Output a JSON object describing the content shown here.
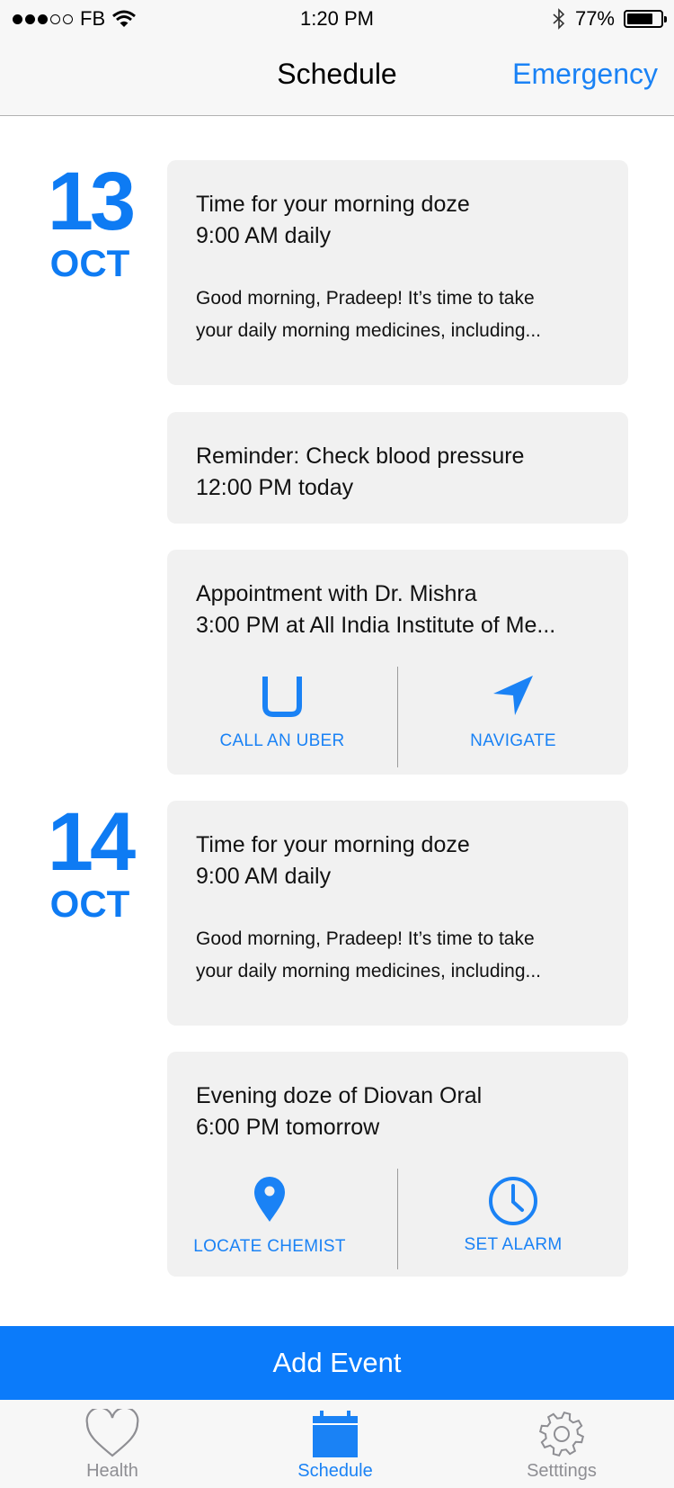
{
  "status_bar": {
    "carrier": "FB",
    "time": "1:20 PM",
    "battery_percent": "77%",
    "battery_level": 0.77,
    "signal_bars_filled": 3,
    "signal_bars_total": 5
  },
  "nav": {
    "title": "Schedule",
    "emergency_label": "Emergency"
  },
  "days": [
    {
      "day": "13",
      "month": "OCT",
      "events": [
        {
          "title": "Time for your morning doze",
          "subtitle": "9:00 AM daily",
          "body_line1": "Good morning, Pradeep! It’s time to take",
          "body_line2": "your daily morning medicines, including..."
        },
        {
          "title": "Reminder: Check blood pressure",
          "subtitle": "12:00 PM today"
        },
        {
          "title": "Appointment with Dr. Mishra",
          "subtitle": "3:00 PM at All India Institute of Me...",
          "actions": [
            {
              "label": "CALL AN UBER",
              "icon": "uber-icon"
            },
            {
              "label": "NAVIGATE",
              "icon": "navigate-arrow-icon"
            }
          ]
        }
      ]
    },
    {
      "day": "14",
      "month": "OCT",
      "events": [
        {
          "title": "Time for your morning doze",
          "subtitle": "9:00 AM daily",
          "body_line1": "Good morning, Pradeep! It’s time to take",
          "body_line2": "your daily morning medicines, including..."
        },
        {
          "title": "Evening doze of Diovan Oral",
          "subtitle": "6:00 PM tomorrow",
          "actions": [
            {
              "label": "LOCATE CHEMIST",
              "icon": "map-pin-icon"
            },
            {
              "label": "SET ALARM",
              "icon": "clock-icon"
            }
          ]
        }
      ]
    }
  ],
  "add_event_label": "Add Event",
  "tabs": [
    {
      "label": "Health",
      "icon": "heart-icon",
      "active": false
    },
    {
      "label": "Schedule",
      "icon": "calendar-icon",
      "active": true
    },
    {
      "label": "Setttings",
      "icon": "gear-icon",
      "active": false
    }
  ],
  "colors": {
    "accent": "#1a82f5",
    "add_event_bg": "#0b7bfa",
    "card_bg": "#f1f1f1",
    "tab_inactive": "#8e8e93"
  }
}
